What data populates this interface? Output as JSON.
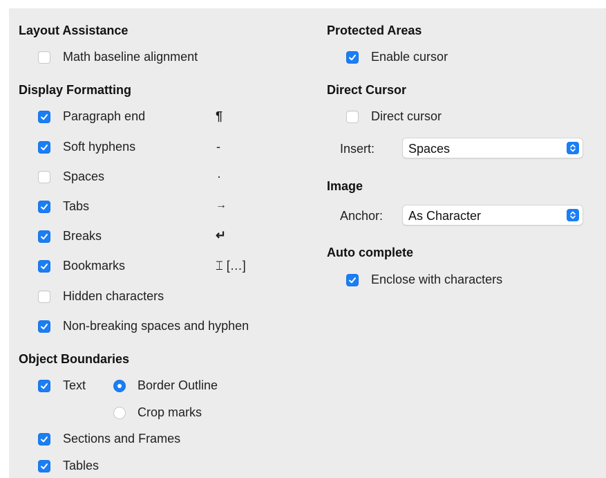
{
  "colors": {
    "accent": "#1a7ef5",
    "panel": "#ececec"
  },
  "layout_assistance": {
    "heading": "Layout Assistance",
    "math_baseline": {
      "label": "Math baseline alignment",
      "checked": false
    }
  },
  "display_formatting": {
    "heading": "Display Formatting",
    "items": [
      {
        "label": "Paragraph end",
        "symbol": "¶",
        "checked": true
      },
      {
        "label": "Soft hyphens",
        "symbol": "-",
        "checked": true
      },
      {
        "label": "Spaces",
        "symbol": "·",
        "checked": false
      },
      {
        "label": "Tabs",
        "symbol": "→",
        "checked": true
      },
      {
        "label": "Breaks",
        "symbol": "↵",
        "checked": true
      },
      {
        "label": "Bookmarks",
        "symbol": "⌶ […]",
        "checked": true
      },
      {
        "label": "Hidden characters",
        "symbol": "",
        "checked": false
      },
      {
        "label": "Non-breaking spaces and hyphen",
        "symbol": "",
        "checked": true
      }
    ]
  },
  "object_boundaries": {
    "heading": "Object Boundaries",
    "text": {
      "label": "Text",
      "checked": true
    },
    "border_outline": {
      "label": "Border Outline",
      "selected": true
    },
    "crop_marks": {
      "label": "Crop marks",
      "selected": false
    },
    "sections_frames": {
      "label": "Sections and Frames",
      "checked": true
    },
    "tables": {
      "label": "Tables",
      "checked": true
    }
  },
  "protected_areas": {
    "heading": "Protected Areas",
    "enable_cursor": {
      "label": "Enable cursor",
      "checked": true
    }
  },
  "direct_cursor": {
    "heading": "Direct Cursor",
    "direct_cursor": {
      "label": "Direct cursor",
      "checked": false
    },
    "insert_label": "Insert:",
    "insert_value": "Spaces"
  },
  "image": {
    "heading": "Image",
    "anchor_label": "Anchor:",
    "anchor_value": "As Character"
  },
  "auto_complete": {
    "heading": "Auto complete",
    "enclose": {
      "label": "Enclose with characters",
      "checked": true
    }
  }
}
